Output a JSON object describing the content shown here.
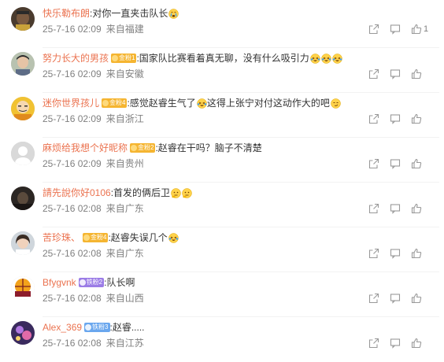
{
  "comments": [
    {
      "username": "快乐勒布朗",
      "badge": null,
      "content": ":对你一直夹击队长",
      "emojis": [
        "cry"
      ],
      "time": "25-7-16 02:09",
      "location": "来自福建",
      "likes": "1",
      "avatar": "lebron"
    },
    {
      "username": "努力长大的男孩",
      "badge": {
        "text": "金粉1",
        "style": "gold"
      },
      "content": ":国家队比赛看着真无聊，没有什么吸引力",
      "emojis": [
        "laugh-cry",
        "laugh-cry",
        "laugh-cry"
      ],
      "time": "25-7-16 02:09",
      "location": "来自安徽",
      "likes": "",
      "avatar": "boy"
    },
    {
      "username": "迷你世界孩儿",
      "badge": {
        "text": "金粉4",
        "style": "gold"
      },
      "content": ":感觉赵睿生气了",
      "content2": "这得上张宁对付这动作大的吧",
      "emojis": [
        "laugh-cry"
      ],
      "emojis2": [
        "smirk"
      ],
      "time": "25-7-16 02:09",
      "location": "来自浙江",
      "likes": "",
      "avatar": "monk"
    },
    {
      "username": "麻烦给我想个好昵称",
      "badge": {
        "text": "金粉2",
        "style": "gold"
      },
      "content": ":赵睿在干吗？脑子不清楚",
      "emojis": [],
      "time": "25-7-16 02:09",
      "location": "来自贵州",
      "likes": "",
      "avatar": "default"
    },
    {
      "username": "請先說你好0106",
      "badge": null,
      "content": ":首发的俩后卫",
      "emojis": [
        "think",
        "think"
      ],
      "time": "25-7-16 02:08",
      "location": "来自广东",
      "likes": "",
      "avatar": "dark"
    },
    {
      "username": "苦珍珠、",
      "badge": {
        "text": "金粉4",
        "style": "gold"
      },
      "content": ":赵睿失误几个",
      "emojis": [
        "laugh-cry"
      ],
      "time": "25-7-16 02:08",
      "location": "来自广东",
      "likes": "",
      "avatar": "girl"
    },
    {
      "username": "Bfygvnk",
      "badge": {
        "text": "铁粉2",
        "style": "purple"
      },
      "content": ":队长啊",
      "emojis": [],
      "time": "25-7-16 02:08",
      "location": "来自山西",
      "likes": "",
      "avatar": "logo"
    },
    {
      "username": "Alex_369",
      "badge": {
        "text": "铁粉3",
        "style": "blue"
      },
      "content": ":赵睿.....",
      "emojis": [],
      "time": "25-7-16 02:08",
      "location": "来自江苏",
      "likes": "",
      "avatar": "purple"
    }
  ],
  "icons": {
    "share": "share-icon",
    "comment": "comment-icon",
    "like": "like-icon"
  },
  "colors": {
    "username": "#eb7350",
    "meta": "#808080",
    "icon": "#999999"
  }
}
